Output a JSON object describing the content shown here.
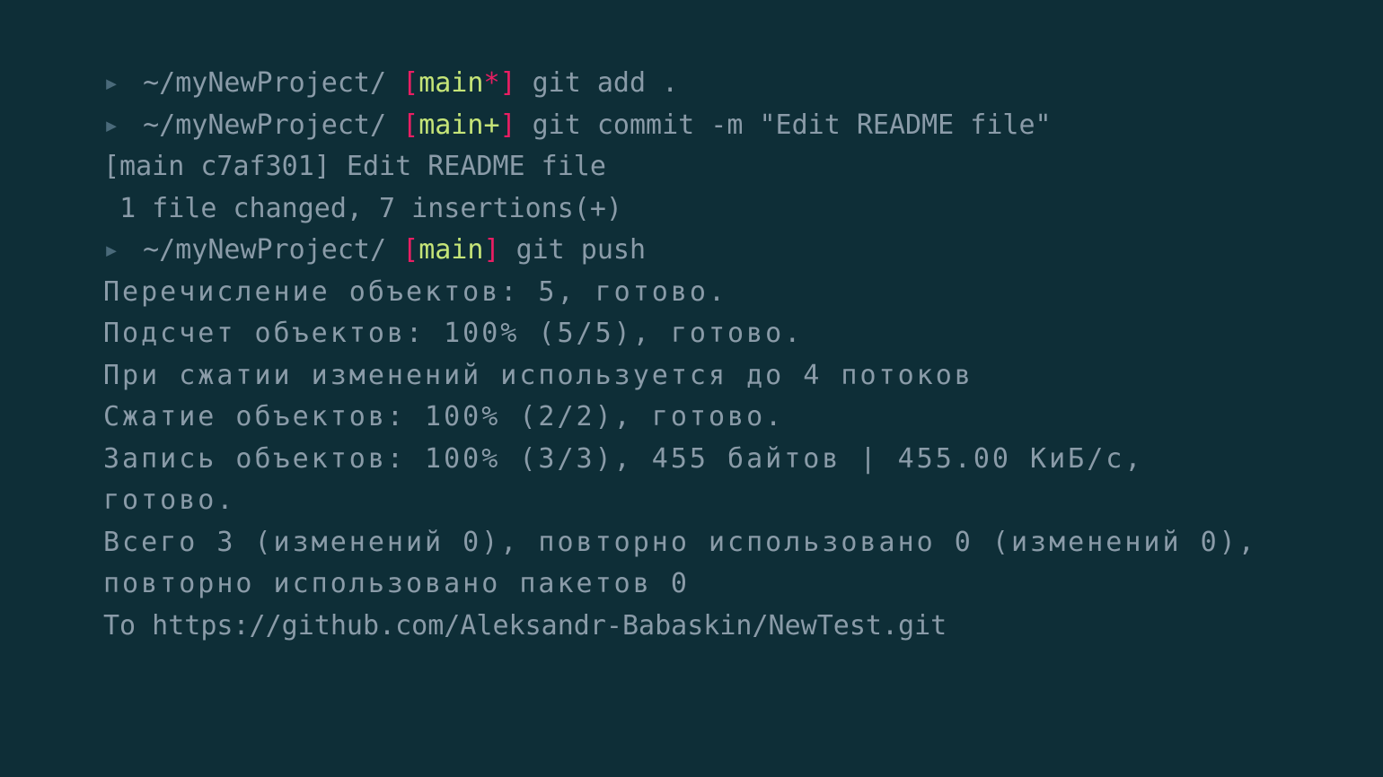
{
  "prompts": [
    {
      "path": "~/myNewProject/",
      "branch": "main",
      "dirty_marker": "*",
      "command": "git add ."
    },
    {
      "path": "~/myNewProject/",
      "branch": "main",
      "dirty_marker": "+",
      "command": "git commit -m \"Edit README file\""
    },
    {
      "path": "~/myNewProject/",
      "branch": "main",
      "dirty_marker": "",
      "command": "git push"
    }
  ],
  "commit_output": {
    "line1": "[main c7af301] Edit README file",
    "line2": " 1 file changed, 7 insertions(+)"
  },
  "push_output": {
    "line1": "Перечисление объектов: 5, готово.",
    "line2": "Подсчет объектов: 100% (5/5), готово.",
    "line3": "При сжатии изменений используется до 4 потоков",
    "line4": "Сжатие объектов: 100% (2/2), готово.",
    "line5": "Запись объектов: 100% (3/3), 455 байтов | 455.00 КиБ/с, готово.",
    "line6": "Всего 3 (изменений 0), повторно использовано 0 (изменений 0), повторно использовано пакетов 0",
    "line7": "To https://github.com/Aleksandr-Babaskin/NewTest.git"
  }
}
